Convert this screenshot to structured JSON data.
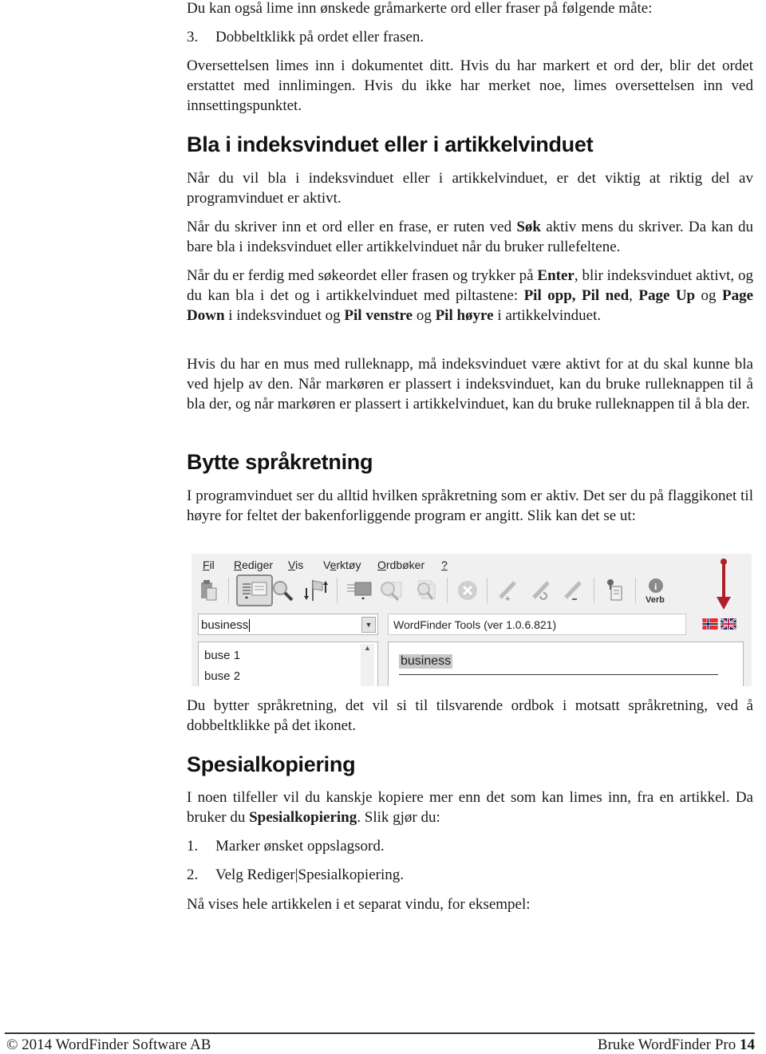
{
  "intro": {
    "para1": "Du kan også lime inn ønskede gråmarkerte ord eller fraser på følgende måte:",
    "step3_num": "3.",
    "step3_text": "Dobbeltklikk på ordet eller frasen.",
    "para2": "Oversettelsen limes inn i dokumentet ditt. Hvis du har markert et ord der, blir det ordet erstattet med innlimingen. Hvis du ikke har merket noe, limes oversettelsen inn ved innsettingspunktet."
  },
  "section1": {
    "heading": "Bla i indeksvinduet eller i artikkelvinduet",
    "para1": "Når du vil bla i indeksvinduet eller i artikkelvinduet, er det viktig at riktig del av programvinduet er aktivt.",
    "para2_a": "Når du skriver inn et ord eller en frase, er ruten ved ",
    "para2_b": "Søk",
    "para2_c": " aktiv mens du skriver. Da kan du bare bla i indeksvinduet eller artikkelvinduet når du bruker rullefeltene.",
    "para3": {
      "t1": "Når du er ferdig med søkeordet eller frasen og trykker på ",
      "b1": "Enter",
      "t2": ", blir indeksvinduet aktivt, og du kan bla i det og i artikkelvinduet med piltastene: ",
      "b2": "Pil opp",
      "t3": ", ",
      "b3": "Pil ned",
      "t4": ", ",
      "b4": "Page Up",
      "t5": " og ",
      "b5": "Page Down",
      "t6": " i indeksvinduet og ",
      "b6": "Pil venstre",
      "t7": " og ",
      "b7": "Pil høyre",
      "t8": " i artikkelvinduet."
    },
    "para4": "Hvis du har en mus med rulleknapp, må indeksvinduet være aktivt for at du skal kunne bla ved hjelp av den. Når markøren er plassert i indeksvinduet, kan du bruke rulleknappen til å bla der, og når markøren er plassert i artikkelvinduet, kan du bruke rulleknappen til å bla der."
  },
  "section2": {
    "heading": "Bytte språkretning",
    "para1": "I programvinduet ser du alltid hvilken språkretning som er aktiv. Det ser du på flaggikonet til høyre for feltet der bakenforliggende program er angitt. Slik kan det se ut:",
    "para2": "Du bytter språkretning, det vil si til tilsvarende ordbok i motsatt språkretning, ved å dobbeltklikke på det ikonet."
  },
  "screenshot": {
    "menu": [
      {
        "label": "Fil",
        "ul": "F",
        "rest": "il"
      },
      {
        "label": "Rediger",
        "ul": "R",
        "rest": "ediger"
      },
      {
        "label": "Vis",
        "ul": "V",
        "rest": "is"
      },
      {
        "label": "Verktøy",
        "pre": "V",
        "ul": "e",
        "rest": "rktøy"
      },
      {
        "label": "Ordbøker",
        "ul": "O",
        "rest": "rdbøker"
      },
      {
        "label": "?",
        "ul": "?",
        "rest": ""
      }
    ],
    "verb_label": "Verb",
    "search_value": "business",
    "program_field": "WordFinder Tools (ver 1.0.6.821)",
    "index_items": [
      "buse 1",
      "buse 2"
    ],
    "headword": "business",
    "flag_from": "Norwegian",
    "flag_to": "English",
    "arrow_color": "#b0202a"
  },
  "section3": {
    "heading": "Spesialkopiering",
    "para1_a": "I noen tilfeller vil du kanskje kopiere mer enn det som kan limes inn, fra en artikkel. Da bruker du ",
    "para1_b": "Spesialkopiering",
    "para1_c": ". Slik gjør du:",
    "steps": [
      {
        "num": "1.",
        "text": "Marker ønsket oppslagsord."
      },
      {
        "num": "2.",
        "text": "Velg Rediger|Spesialkopiering."
      }
    ],
    "para2": "Nå vises hele artikkelen i et separat vindu, for eksempel:"
  },
  "footer": {
    "left": "© 2014 WordFinder Software AB",
    "right_text": "Bruke WordFinder Pro ",
    "page_number": "14"
  }
}
